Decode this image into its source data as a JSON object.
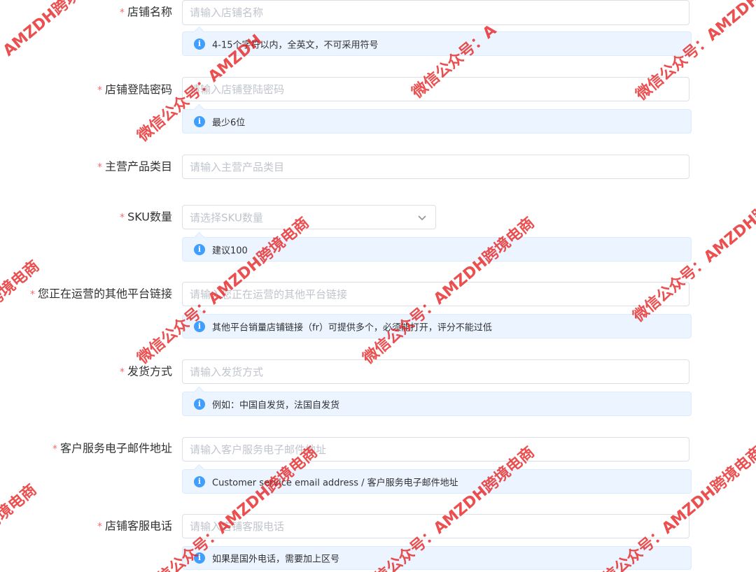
{
  "required_mark": "*",
  "fields": [
    {
      "label": "店铺名称",
      "placeholder": "请输入店铺名称",
      "hint": "4-15个字符以内，全英文，不可采用符号"
    },
    {
      "label": "店铺登陆密码",
      "placeholder": "请输入店铺登陆密码",
      "hint": "最少6位"
    },
    {
      "label": "主营产品类目",
      "placeholder": "请输入主营产品类目"
    },
    {
      "label": "SKU数量",
      "placeholder": "请选择SKU数量",
      "hint": "建议100"
    },
    {
      "label": "您正在运营的其他平台链接",
      "placeholder": "请输入您正在运营的其他平台链接",
      "hint": "其他平台销量店铺链接（fr）可提供多个，必须能打开，评分不能过低"
    },
    {
      "label": "发货方式",
      "placeholder": "请输入发货方式",
      "hint": "例如：中国自发货，法国自发货"
    },
    {
      "label": "客户服务电子邮件地址",
      "placeholder": "请输入客户服务电子邮件地址",
      "hint": "Customer service email address / 客户服务电子邮件地址"
    },
    {
      "label": "店铺客服电话",
      "placeholder": "请输入店铺客服电话",
      "hint": "如果是国外电话，需要加上区号"
    }
  ],
  "icons": {
    "hint": "info-icon",
    "select": "chevron-down-icon"
  },
  "colors": {
    "required": "#f56c6c",
    "info": "#409eff",
    "hint_bg": "#ecf5ff",
    "watermark": "#e61e1e"
  },
  "watermark": {
    "text_a": "微信公众号：AMZDH跨境电商",
    "text_b": "AMZDH跨境电商",
    "text_c": "微信公众号：AMZDH",
    "text_d": "微信公众号：A",
    "text_e": "跨境电商"
  }
}
